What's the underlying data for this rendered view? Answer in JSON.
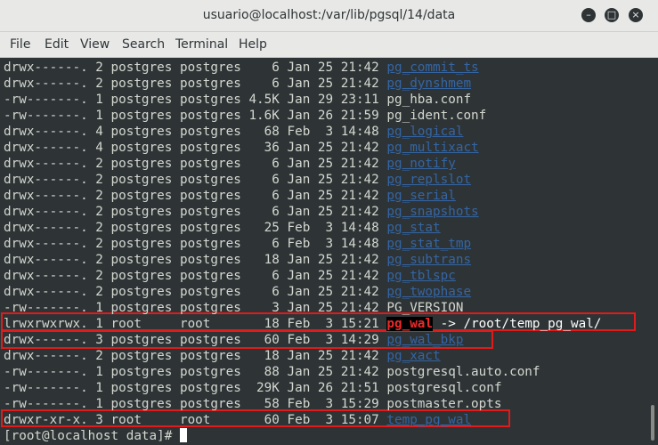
{
  "window": {
    "title": "usuario@localhost:/var/lib/pgsql/14/data"
  },
  "controls": {
    "minimize": "–",
    "maximize": "□",
    "close": "×"
  },
  "menu": [
    "File",
    "Edit",
    "View",
    "Search",
    "Terminal",
    "Help"
  ],
  "colors": {
    "directory": "#3465a4",
    "text": "#d3d7cf",
    "highlight_box": "#e01b1b",
    "broken_link_bg": "#000000",
    "broken_link_fg": "#ef2929"
  },
  "listing": [
    {
      "meta": "drwx------. 2 postgres postgres    6 Jan 25 21:42 ",
      "name": "pg_commit_ts",
      "kind": "dir"
    },
    {
      "meta": "drwx------. 2 postgres postgres    6 Jan 25 21:42 ",
      "name": "pg_dynshmem",
      "kind": "dir"
    },
    {
      "meta": "-rw-------. 1 postgres postgres 4.5K Jan 29 23:11 ",
      "name": "pg_hba.conf",
      "kind": "file"
    },
    {
      "meta": "-rw-------. 1 postgres postgres 1.6K Jan 26 21:59 ",
      "name": "pg_ident.conf",
      "kind": "file"
    },
    {
      "meta": "drwx------. 4 postgres postgres   68 Feb  3 14:48 ",
      "name": "pg_logical",
      "kind": "dir"
    },
    {
      "meta": "drwx------. 4 postgres postgres   36 Jan 25 21:42 ",
      "name": "pg_multixact",
      "kind": "dir"
    },
    {
      "meta": "drwx------. 2 postgres postgres    6 Jan 25 21:42 ",
      "name": "pg_notify",
      "kind": "dir"
    },
    {
      "meta": "drwx------. 2 postgres postgres    6 Jan 25 21:42 ",
      "name": "pg_replslot",
      "kind": "dir"
    },
    {
      "meta": "drwx------. 2 postgres postgres    6 Jan 25 21:42 ",
      "name": "pg_serial",
      "kind": "dir"
    },
    {
      "meta": "drwx------. 2 postgres postgres    6 Jan 25 21:42 ",
      "name": "pg_snapshots",
      "kind": "dir"
    },
    {
      "meta": "drwx------. 2 postgres postgres   25 Feb  3 14:48 ",
      "name": "pg_stat",
      "kind": "dir"
    },
    {
      "meta": "drwx------. 2 postgres postgres    6 Feb  3 14:48 ",
      "name": "pg_stat_tmp",
      "kind": "dir"
    },
    {
      "meta": "drwx------. 2 postgres postgres   18 Jan 25 21:42 ",
      "name": "pg_subtrans",
      "kind": "dir"
    },
    {
      "meta": "drwx------. 2 postgres postgres    6 Jan 25 21:42 ",
      "name": "pg_tblspc",
      "kind": "dir"
    },
    {
      "meta": "drwx------. 2 postgres postgres    6 Jan 25 21:42 ",
      "name": "pg_twophase",
      "kind": "dir"
    },
    {
      "meta": "-rw-------. 1 postgres postgres    3 Jan 25 21:42 ",
      "name": "PG_VERSION",
      "kind": "file"
    },
    {
      "meta": "lrwxrwxrwx. 1 root     root       18 Feb  3 15:21 ",
      "name": "pg_wal",
      "kind": "brokenlink",
      "arrow": " -> ",
      "target": "/root/temp_pg_wal/",
      "highlighted": true
    },
    {
      "meta": "drwx------. 3 postgres postgres   60 Feb  3 14:29 ",
      "name": "pg_wal_bkp",
      "kind": "dir",
      "highlighted": true
    },
    {
      "meta": "drwx------. 2 postgres postgres   18 Jan 25 21:42 ",
      "name": "pg_xact",
      "kind": "dir"
    },
    {
      "meta": "-rw-------. 1 postgres postgres   88 Jan 25 21:42 ",
      "name": "postgresql.auto.conf",
      "kind": "file"
    },
    {
      "meta": "-rw-------. 1 postgres postgres  29K Jan 26 21:51 ",
      "name": "postgresql.conf",
      "kind": "file"
    },
    {
      "meta": "-rw-------. 1 postgres postgres   58 Feb  3 15:29 ",
      "name": "postmaster.opts",
      "kind": "file"
    },
    {
      "meta": "drwxr-xr-x. 3 root     root       60 Feb  3 15:07 ",
      "name": "temp_pg_wal",
      "kind": "dir",
      "highlighted": true
    }
  ],
  "prompt": "[root@localhost data]# "
}
